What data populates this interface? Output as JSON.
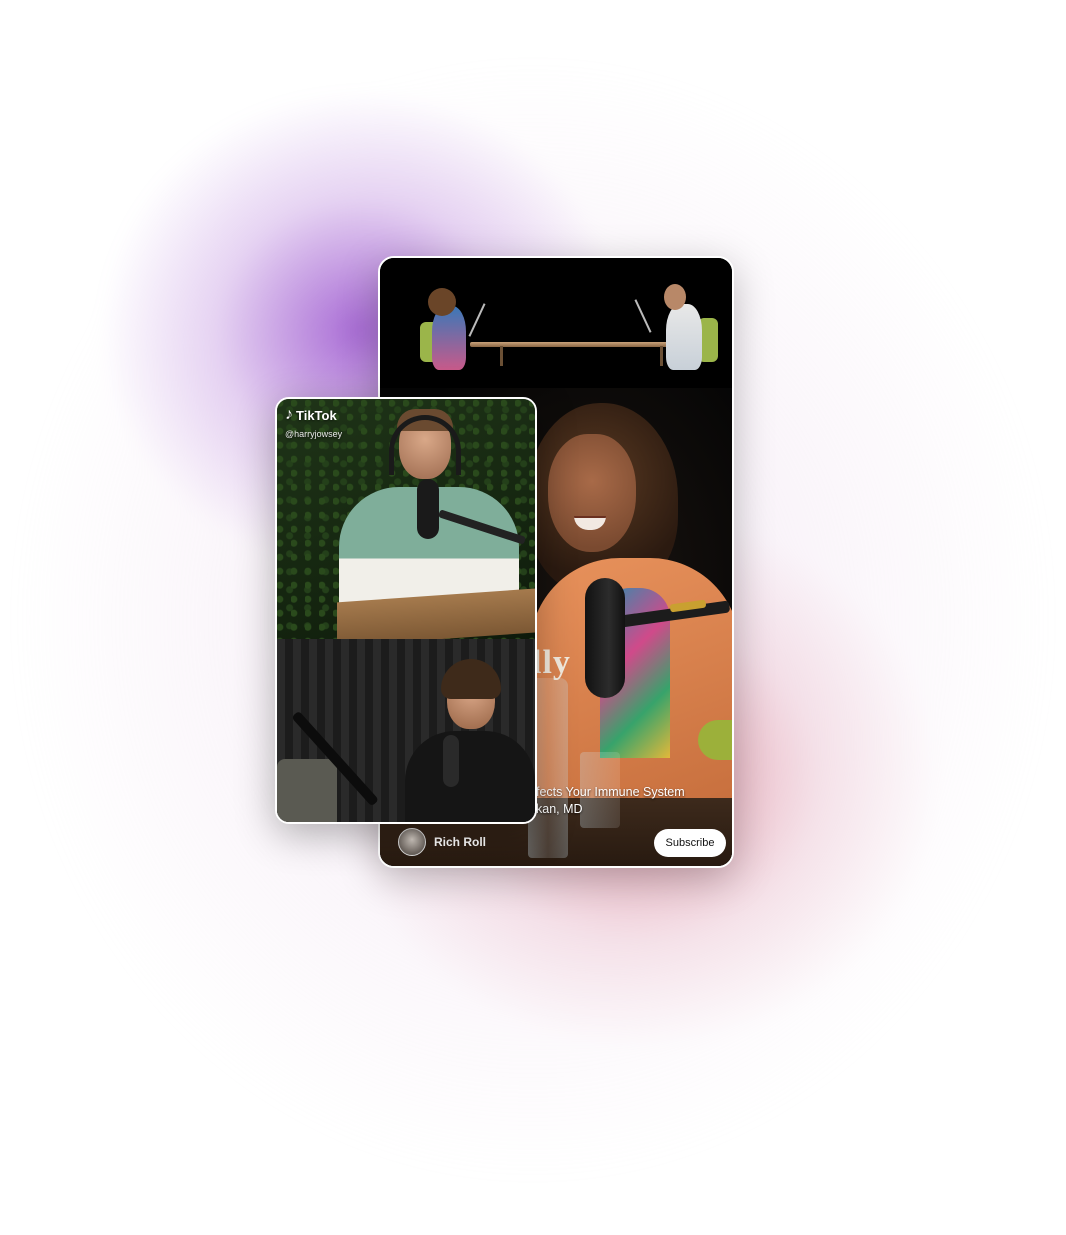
{
  "youtube_card": {
    "title_partial": "lly",
    "caption_line1": "fects Your Immune System",
    "caption_line2": "kan, MD",
    "channel_name": "Rich Roll",
    "subscribe_label": "Subscribe"
  },
  "tiktok_card": {
    "brand": "TikTok",
    "brand_icon": "tiktok-note-icon",
    "handle": "@harryjowsey"
  },
  "colors": {
    "glow_purple": "#8c3cc8",
    "glow_pink": "#d25a6e",
    "card_border": "#ffffff"
  }
}
